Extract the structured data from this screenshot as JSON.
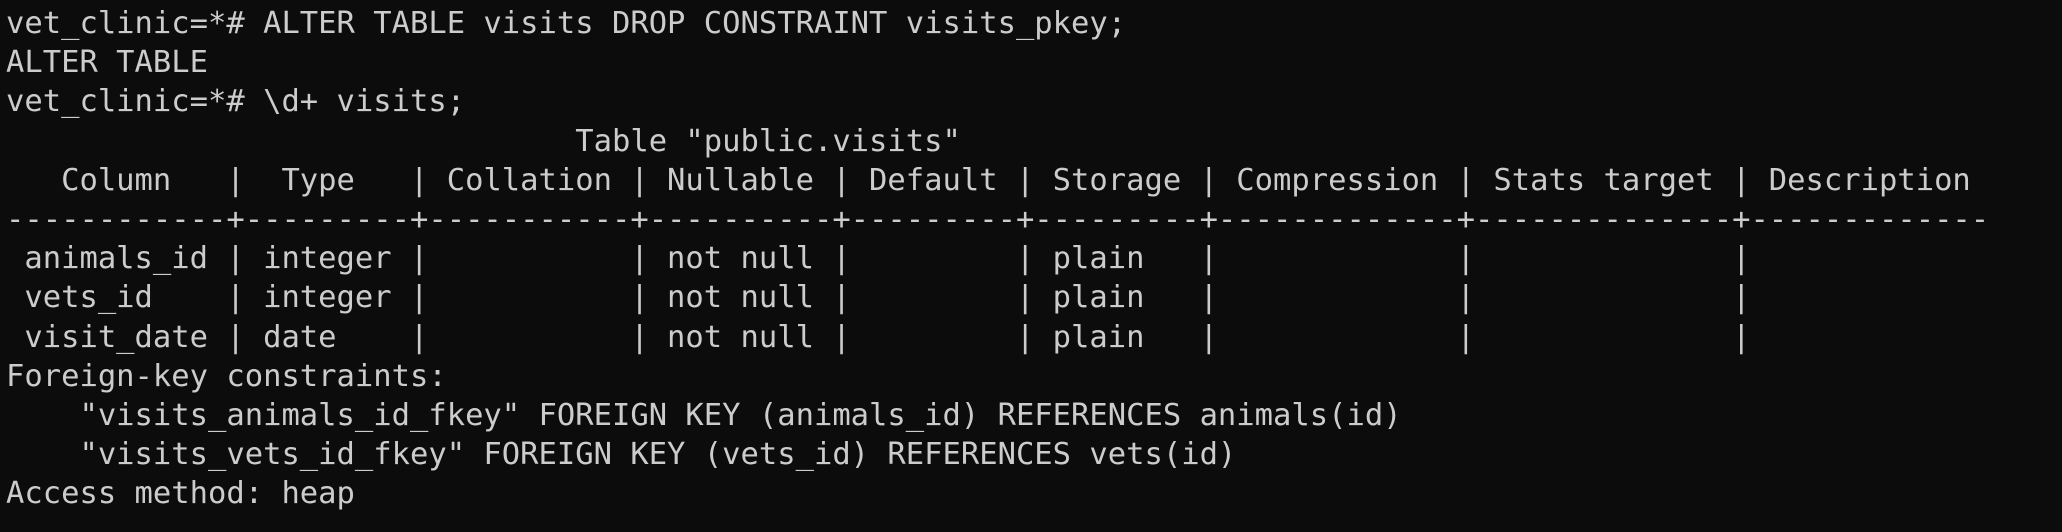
{
  "terminal": {
    "lines": [
      "vet_clinic=*# ALTER TABLE visits DROP CONSTRAINT visits_pkey;",
      "ALTER TABLE",
      "vet_clinic=*# \\d+ visits;",
      "                               Table \"public.visits\"",
      "   Column   |  Type   | Collation | Nullable | Default | Storage | Compression | Stats target | Description",
      "------------+---------+-----------+----------+---------+---------+-------------+--------------+-------------",
      " animals_id | integer |           | not null |         | plain   |             |              |",
      " vets_id    | integer |           | not null |         | plain   |             |              |",
      " visit_date | date    |           | not null |         | plain   |             |              |",
      "Foreign-key constraints:",
      "    \"visits_animals_id_fkey\" FOREIGN KEY (animals_id) REFERENCES animals(id)",
      "    \"visits_vets_id_fkey\" FOREIGN KEY (vets_id) REFERENCES vets(id)",
      "Access method: heap"
    ]
  },
  "colors": {
    "background": "#0c0c0c",
    "foreground": "#cccccc"
  }
}
